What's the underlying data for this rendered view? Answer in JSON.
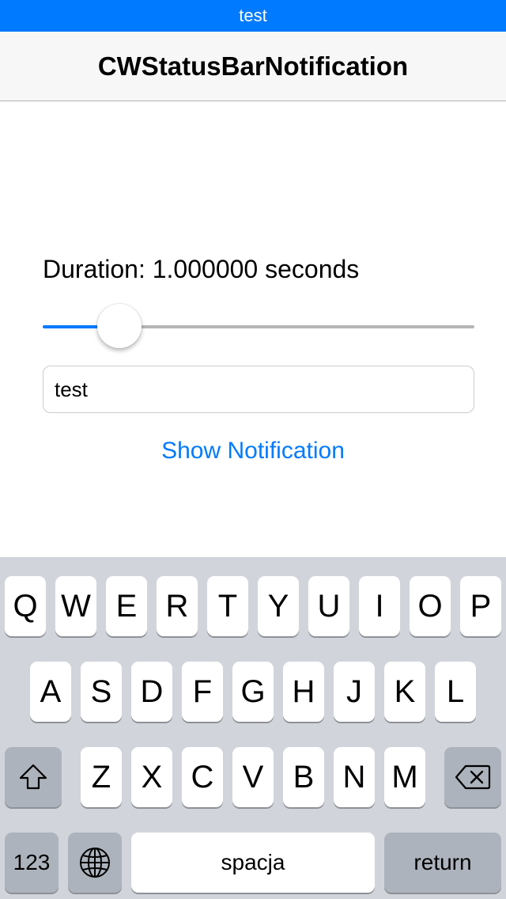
{
  "notification": {
    "text": "test"
  },
  "nav": {
    "title": "CWStatusBarNotification"
  },
  "main": {
    "duration_label": "Duration: 1.000000 seconds",
    "slider": {
      "value_fraction": 0.14
    },
    "text_field_value": "test",
    "show_button_label": "Show Notification"
  },
  "keyboard": {
    "rows": [
      [
        "Q",
        "W",
        "E",
        "R",
        "T",
        "Y",
        "U",
        "I",
        "O",
        "P"
      ],
      [
        "A",
        "S",
        "D",
        "F",
        "G",
        "H",
        "J",
        "K",
        "L"
      ],
      [
        "Z",
        "X",
        "C",
        "V",
        "B",
        "N",
        "M"
      ]
    ],
    "numbers_label": "123",
    "space_label": "spacja",
    "return_label": "return",
    "icons": [
      "shift-icon",
      "backspace-icon",
      "globe-icon"
    ]
  },
  "colors": {
    "accent": "#007aff",
    "keyboard_bg": "#d1d5db",
    "key_gray": "#adb3bc"
  }
}
